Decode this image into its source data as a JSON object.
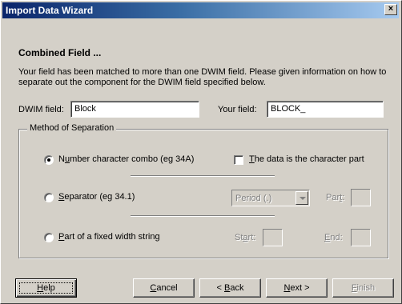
{
  "window": {
    "title": "Import Data Wizard",
    "close_label": "×"
  },
  "page": {
    "heading": "Combined Field ...",
    "description": "Your field has been matched to more than one DWIM field.  Please given information on how to separate out the component for the DWIM field specified below."
  },
  "fields": {
    "dwim_label": "DWIM field:",
    "dwim_value": "Block",
    "your_label": "Your field:",
    "your_value": "BLOCK_"
  },
  "separation": {
    "group_label": "Method of Separation",
    "options": [
      {
        "prefix": "N",
        "underlined": "u",
        "rest": "mber character combo (eg 34A)",
        "selected": true
      },
      {
        "prefix": "",
        "underlined": "S",
        "rest": "eparator (eg 34.1)",
        "selected": false
      },
      {
        "prefix": "",
        "underlined": "P",
        "rest": "art of a fixed width string",
        "selected": false
      }
    ],
    "character_part": {
      "underlined": "T",
      "rest": "he data is the character part",
      "checked": false
    },
    "separator_combo": {
      "selected": "Period (.)"
    },
    "part_label": {
      "prefix": "Par",
      "underlined": "t",
      "rest": ":"
    },
    "start_label": {
      "prefix": "St",
      "underlined": "a",
      "rest": "rt:"
    },
    "end_label": {
      "prefix": "",
      "underlined": "E",
      "rest": "nd:"
    }
  },
  "buttons": {
    "help": {
      "underlined": "H",
      "rest": "elp"
    },
    "cancel": {
      "underlined": "C",
      "rest": "ancel"
    },
    "back": {
      "prefix": "< ",
      "underlined": "B",
      "rest": "ack"
    },
    "next": {
      "underlined": "N",
      "rest": "ext >"
    },
    "finish": {
      "underlined": "F",
      "rest": "inish"
    }
  }
}
